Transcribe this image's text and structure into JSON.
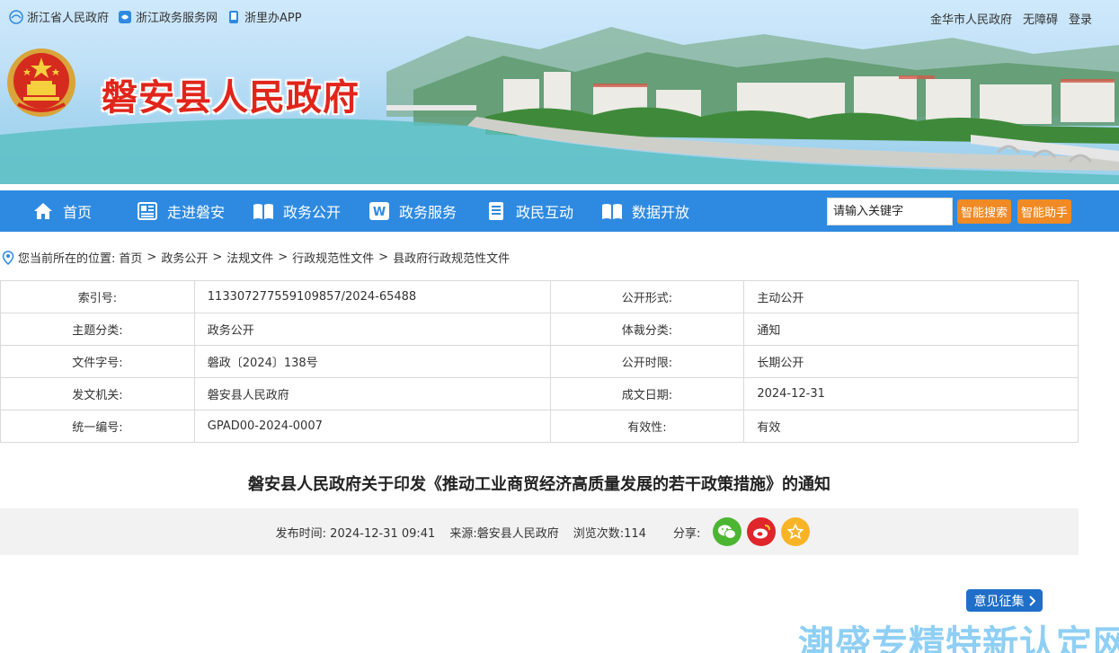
{
  "top_links": [
    {
      "label": "浙江省人民政府",
      "icon": "zhejiang-gov-icon"
    },
    {
      "label": "浙江政务服务网",
      "icon": "zj-service-icon"
    },
    {
      "label": "浙里办APP",
      "icon": "mobile-app-icon"
    }
  ],
  "top_right": {
    "city": "金华市人民政府",
    "accessibility": "无障碍",
    "login": "登录"
  },
  "site": {
    "name": "磐安县人民政府",
    "emblem_icon": "national-emblem-icon"
  },
  "nav": {
    "items": [
      {
        "label": "首页",
        "icon": "home-icon"
      },
      {
        "label": "走进磐安",
        "icon": "news-icon"
      },
      {
        "label": "政务公开",
        "icon": "book-icon"
      },
      {
        "label": "政务服务",
        "icon": "word-icon"
      },
      {
        "label": "政民互动",
        "icon": "document-icon"
      },
      {
        "label": "数据开放",
        "icon": "open-book-icon"
      }
    ],
    "search_placeholder": "请输入关键字",
    "smart_search": "智能搜索",
    "smart_assistant": "智能助手"
  },
  "breadcrumb": {
    "prefix": "您当前所在的位置:",
    "items": [
      "首页",
      "政务公开",
      "法规文件",
      "行政规范性文件",
      "县政府行政规范性文件"
    ],
    "separator": ">"
  },
  "info": [
    [
      "索引号:",
      "113307277559109857/2024-65488",
      "公开形式:",
      "主动公开"
    ],
    [
      "主题分类:",
      "政务公开",
      "体裁分类:",
      "通知"
    ],
    [
      "文件字号:",
      "磐政〔2024〕138号",
      "公开时限:",
      "长期公开"
    ],
    [
      "发文机关:",
      "磐安县人民政府",
      "成文日期:",
      "2024-12-31"
    ],
    [
      "统一编号:",
      "GPAD00-2024-0007",
      "有效性:",
      "有效"
    ]
  ],
  "article": {
    "title": "磐安县人民政府关于印发《推动工业商贸经济高质量发展的若干政策措施》的通知",
    "publish_label": "发布时间:",
    "publish_time": "2024-12-31 09:41",
    "source_label": "来源:",
    "source": "磐安县人民政府",
    "views_label": "浏览次数:",
    "views": "114",
    "share_label": "分享:"
  },
  "share_icons": [
    "wechat-icon",
    "weibo-icon",
    "star-icon"
  ],
  "feedback": "意见征集",
  "watermark": "潮盛专精特新认定网",
  "colors": {
    "nav": "#2e8ae1",
    "accent_red": "#e1251b",
    "orange": "#f08a24",
    "feedback_blue": "#1f6fc9"
  }
}
